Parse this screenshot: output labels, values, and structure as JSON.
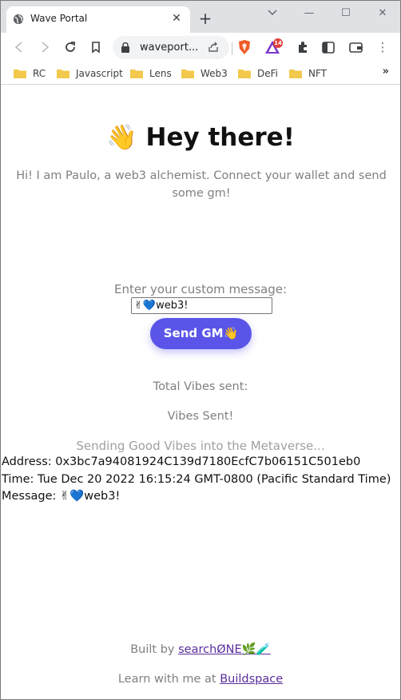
{
  "browser": {
    "tab_title": "Wave Portal",
    "tab_close": "✕",
    "new_tab": "+",
    "url": "waveport...",
    "extension_badge": "14",
    "window_controls": {
      "minimize": "—",
      "maximize": "☐",
      "close": "✕"
    },
    "menu_glyph": "⋮",
    "bookmarks": [
      "RC",
      "Javascript",
      "Lens",
      "Web3",
      "DeFi",
      "NFT"
    ],
    "bookmarks_more": "»"
  },
  "page": {
    "heading": "👋 Hey there!",
    "bio": "Hi! I am Paulo, a web3 alchemist. Connect your wallet and send some gm!",
    "prompt_label": "Enter your custom message:",
    "input_value": "✌💙web3!",
    "send_button": "Send GM👋",
    "total_vibes": "Total Vibes sent:",
    "vibes_sent": "Vibes Sent!",
    "sending": "Sending Good Vibes into the Metaverse...",
    "wave": {
      "address_line": "Address: 0x3bc7a94081924C139d7180EcfC7b06151C501eb0",
      "time_line": "Time: Tue Dec 20 2022 16:15:24 GMT-0800 (Pacific Standard Time)",
      "message_line": "Message: ✌💙web3!"
    },
    "footer": {
      "built_prefix": "Built by ",
      "built_link": "searchØNE🌿🧪",
      "learn_prefix": "Learn with me at ",
      "learn_link": "Buildspace"
    }
  },
  "colors": {
    "accent": "#5a55e8",
    "link": "#5a2d9b",
    "muted_text": "#808080",
    "folder": "#f2c94c"
  }
}
